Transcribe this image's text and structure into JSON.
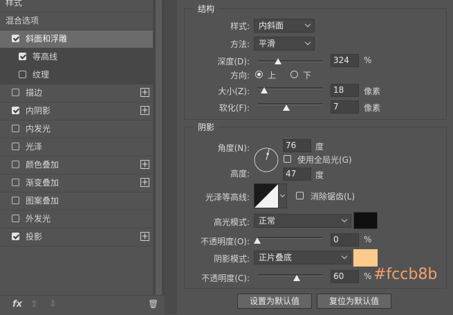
{
  "style_list": {
    "items": [
      {
        "label": "样式",
        "kind": "head"
      },
      {
        "label": "混合选项",
        "kind": "head"
      },
      {
        "label": "斜面和浮雕",
        "kind": "item",
        "checked": true,
        "plus": false,
        "selected": true
      },
      {
        "label": "等高线",
        "kind": "sub",
        "checked": true,
        "plus": false
      },
      {
        "label": "纹理",
        "kind": "sub",
        "checked": false,
        "plus": false
      },
      {
        "label": "描边",
        "kind": "item",
        "checked": false,
        "plus": true
      },
      {
        "label": "内阴影",
        "kind": "item",
        "checked": true,
        "plus": true
      },
      {
        "label": "内发光",
        "kind": "item",
        "checked": false,
        "plus": false
      },
      {
        "label": "光泽",
        "kind": "item",
        "checked": false,
        "plus": false
      },
      {
        "label": "颜色叠加",
        "kind": "item",
        "checked": false,
        "plus": true
      },
      {
        "label": "渐变叠加",
        "kind": "item",
        "checked": false,
        "plus": true
      },
      {
        "label": "图案叠加",
        "kind": "item",
        "checked": false,
        "plus": false
      },
      {
        "label": "外发光",
        "kind": "item",
        "checked": false,
        "plus": false
      },
      {
        "label": "投影",
        "kind": "item",
        "checked": true,
        "plus": true
      }
    ],
    "bottom": {
      "fx": "fx",
      "plus_glyph": "+",
      "up": "⇧",
      "down": "⇩",
      "trash": "🗑"
    }
  },
  "structure": {
    "title": "结构",
    "style_label": "样式:",
    "style_value": "内斜面",
    "method_label": "方法:",
    "method_value": "平滑",
    "depth_label": "深度(D):",
    "depth_value": "324",
    "depth_unit": "%",
    "depth_fraction": 0.32,
    "direction_label": "方向:",
    "dir_up": "上",
    "dir_down": "下",
    "dir_selected": "up",
    "size_label": "大小(Z):",
    "size_value": "18",
    "size_unit": "像素",
    "size_fraction": 0.1,
    "soften_label": "软化(F):",
    "soften_value": "7",
    "soften_unit": "像素",
    "soften_fraction": 0.44
  },
  "shading": {
    "title": "阴影",
    "angle_label": "角度(N):",
    "angle_value": "76",
    "angle_unit": "度",
    "global_light_label": "使用全局光(G)",
    "global_light_checked": false,
    "altitude_label": "高度:",
    "altitude_value": "47",
    "altitude_unit": "度",
    "gloss_label": "光泽等高线:",
    "antialias_label": "消除锯齿(L)",
    "antialias_checked": false,
    "highlight_label": "高光模式:",
    "highlight_value": "正常",
    "highlight_color": "#0f0f0f",
    "highlight_opacity_label": "不透明度(O):",
    "highlight_opacity_value": "0",
    "highlight_opacity_unit": "%",
    "highlight_opacity_fraction": 0.0,
    "shadow_label": "阴影模式:",
    "shadow_value": "正片叠底",
    "shadow_color": "#fccb8b",
    "shadow_opacity_label": "不透明度(C):",
    "shadow_opacity_value": "60",
    "shadow_opacity_unit": "%",
    "shadow_opacity_fraction": 0.6
  },
  "buttons": {
    "set_default": "设置为默认值",
    "reset_default": "复位为默认值"
  },
  "annotation": "#fccb8b"
}
